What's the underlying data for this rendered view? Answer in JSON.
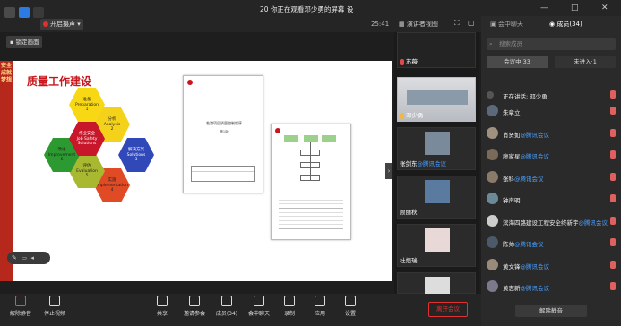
{
  "window": {
    "title": "你正在观看邓少勇的屏幕",
    "badge": "20",
    "view_label": "设",
    "recording": "开启摄声",
    "timer": "25:41",
    "fix_view": "锁定画面",
    "layout_label": "演讲者视图",
    "participants_tab": "成员(34)",
    "chat_tab": "会中聊天"
  },
  "slide": {
    "title": "质量工作建设",
    "band_text": "安全成就梦想",
    "hexes": [
      {
        "cn": "准备",
        "en": "Preparation",
        "n": "1",
        "color": "#f8d814"
      },
      {
        "cn": "分析",
        "en": "Analysis",
        "n": "2",
        "color": "#f4d21a"
      },
      {
        "cn": "解决方案",
        "en": "Solutions",
        "n": "3",
        "color": "#3048b8"
      },
      {
        "cn": "实施",
        "en": "Implementation",
        "n": "4",
        "color": "#e04a24"
      },
      {
        "cn": "评估",
        "en": "Evaluation",
        "n": "5",
        "color": "#a8b830"
      },
      {
        "cn": "改进",
        "en": "Improvement",
        "n": "6",
        "color": "#2c9a30"
      },
      {
        "cn": "作业安全",
        "en": "Job Safety Solutions",
        "n": "",
        "color": "#c8162a"
      }
    ],
    "doc1_title": "临港项目质量控制程序",
    "doc1_sub": "第1版"
  },
  "videos": [
    {
      "name": "苏薇",
      "hl": ""
    },
    {
      "name": "邓少勇",
      "hl": ""
    },
    {
      "name": "张剑东",
      "hl": "@腾讯会议"
    },
    {
      "name": "顾丽秋",
      "hl": ""
    },
    {
      "name": "杜烜瑞",
      "hl": ""
    },
    {
      "name": "",
      "hl": ""
    }
  ],
  "panel": {
    "search_placeholder": "搜索成员",
    "seg_in": "会议中·33",
    "seg_out": "未进入·1",
    "speaking": "正在讲话: 邓少勇",
    "members": [
      {
        "name": "朱章立",
        "hl": ""
      },
      {
        "name": "肖贤如",
        "hl": "@腾讯会议"
      },
      {
        "name": "廖家星",
        "hl": "@腾讯会议"
      },
      {
        "name": "张科",
        "hl": "@腾讯会议"
      },
      {
        "name": "钟声明",
        "hl": ""
      },
      {
        "name": "滨海四路建设工程安全终新宇",
        "hl": "@腾讯会议"
      },
      {
        "name": "陈帅",
        "hl": "@腾讯会议"
      },
      {
        "name": "黄文锋",
        "hl": "@腾讯会议"
      },
      {
        "name": "黄志新",
        "hl": "@腾讯会议"
      }
    ],
    "unmute_all": "解除静音"
  },
  "toolbar": {
    "items": [
      {
        "label": "解除静音",
        "icon": "mic-off-icon"
      },
      {
        "label": "停止视频",
        "icon": "camera-icon"
      },
      {
        "label": "共享",
        "icon": "share-icon"
      },
      {
        "label": "邀请参会",
        "icon": "invite-icon"
      },
      {
        "label": "成员(34)",
        "icon": "members-icon"
      },
      {
        "label": "会中聊天",
        "icon": "chat-icon"
      },
      {
        "label": "录制",
        "icon": "record-icon"
      },
      {
        "label": "应用",
        "icon": "apps-icon"
      },
      {
        "label": "设置",
        "icon": "settings-icon"
      }
    ],
    "end": "离开会议"
  },
  "colors": {
    "accent": "#4aa0ff",
    "end": "#e03030"
  }
}
